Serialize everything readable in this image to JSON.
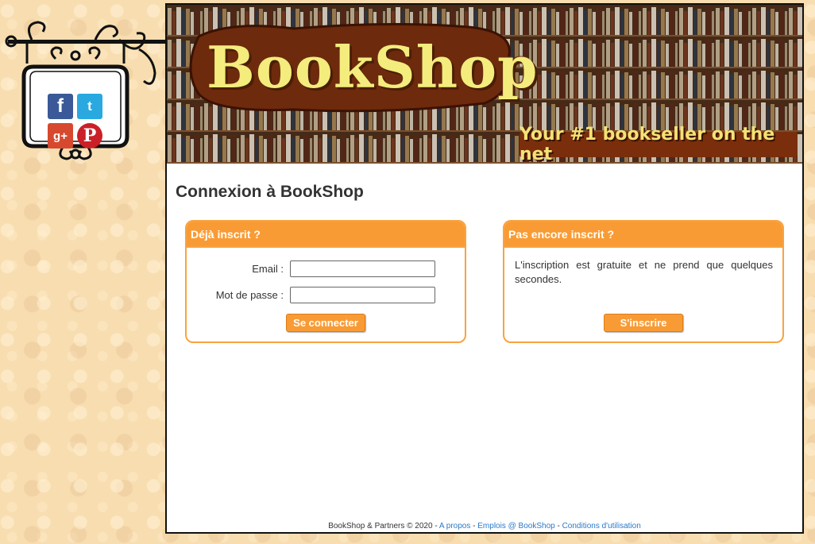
{
  "social": {
    "facebook": "f",
    "twitter": "t",
    "googleplus": "g+",
    "pinterest": "P"
  },
  "banner": {
    "logo_text": "BookShop",
    "tagline": "Your #1 bookseller on the net"
  },
  "page": {
    "title": "Connexion à BookShop"
  },
  "login_panel": {
    "header": "Déjà inscrit ?",
    "email_label": "Email :",
    "email_value": "",
    "password_label": "Mot de passe :",
    "password_value": "",
    "submit_label": "Se connecter"
  },
  "register_panel": {
    "header": "Pas encore inscrit ?",
    "text": "L'inscription est gratuite et ne prend que quelques secondes.",
    "submit_label": "S'inscrire"
  },
  "footer": {
    "copyright": "BookShop & Partners © 2020 -",
    "sep1": " - ",
    "sep2": " - ",
    "link_about": "A propos",
    "link_jobs": "Emplois @ BookShop",
    "link_terms": "Conditions d'utilisation"
  },
  "colors": {
    "accent": "#f99b34",
    "background": "#f7ddb0",
    "link": "#2a7ac8"
  }
}
